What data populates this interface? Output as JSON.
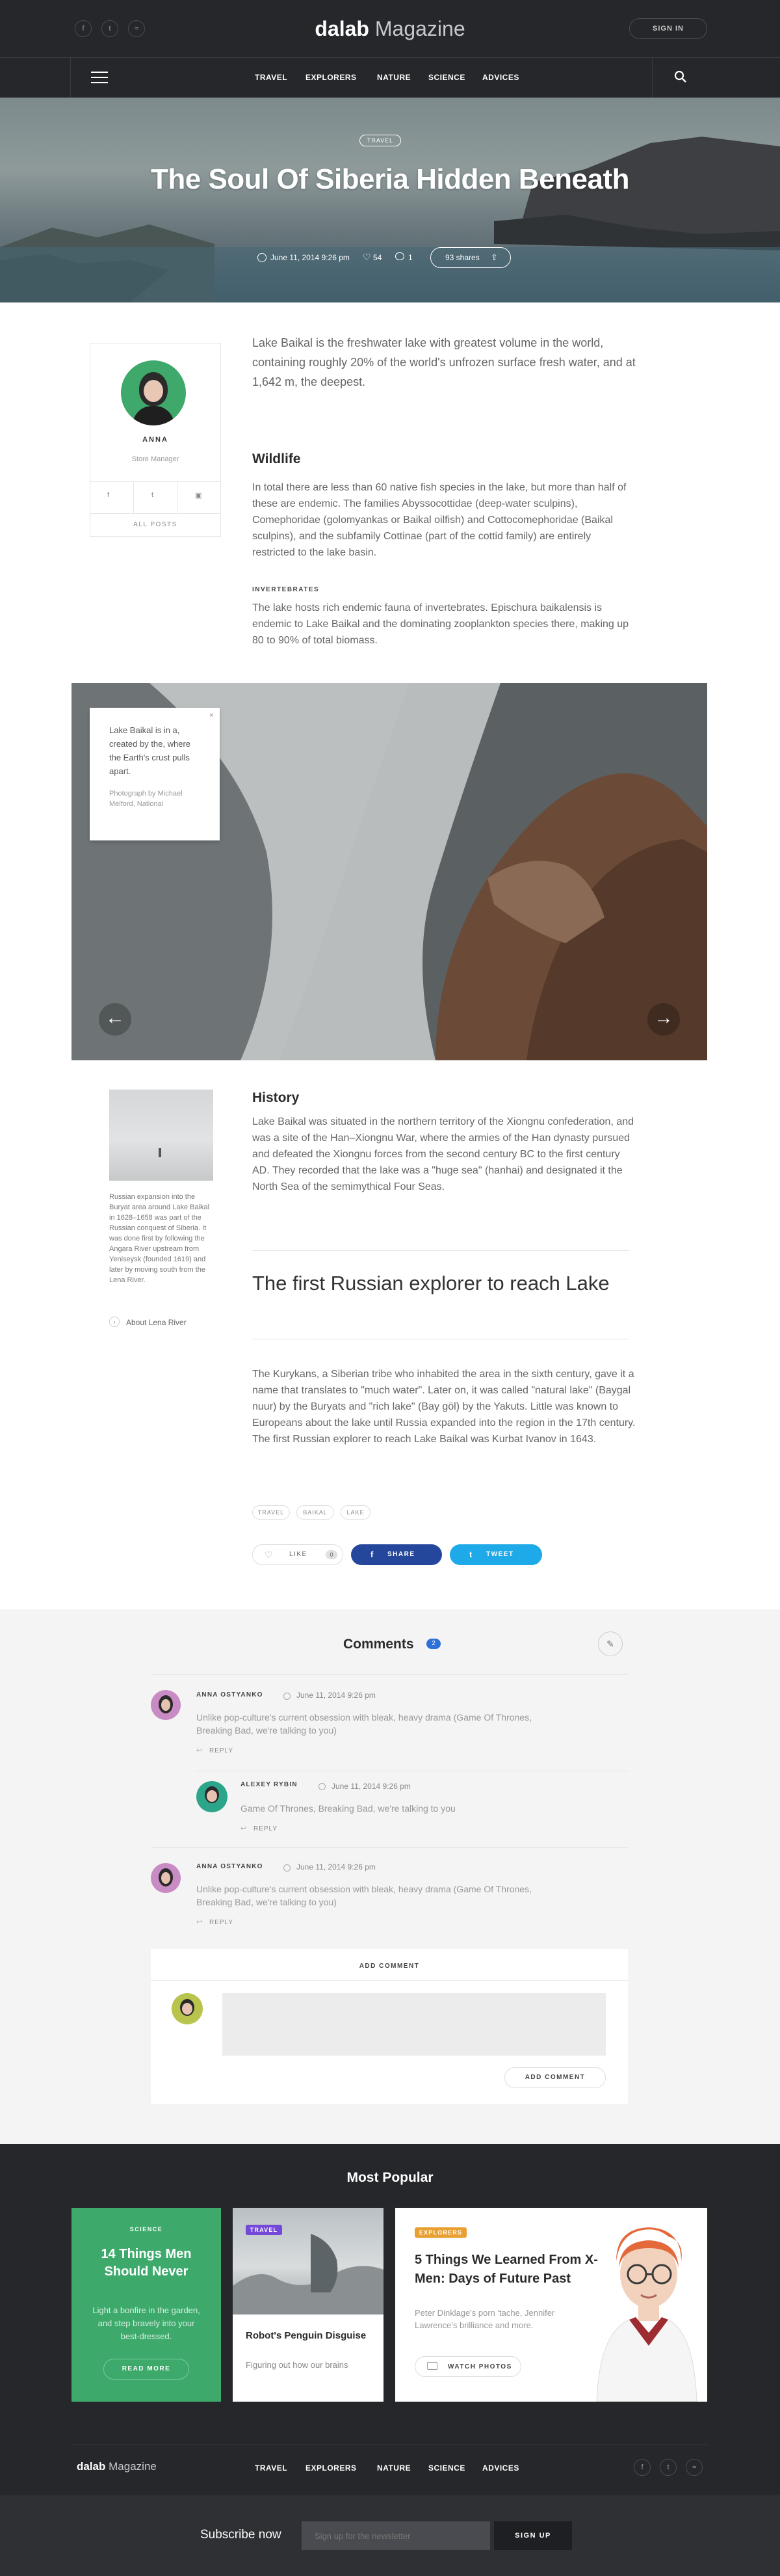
{
  "header": {
    "logo_bold": "dalab",
    "logo_light": "Magazine",
    "sign_in": "SIGN IN",
    "social_icons": [
      "facebook-icon",
      "twitter-icon",
      "rss-icon"
    ],
    "nav": [
      "TRAVEL",
      "EXPLORERS",
      "NATURE",
      "SCIENCE",
      "ADVICES"
    ]
  },
  "hero": {
    "category": "TRAVEL",
    "title": "The Soul Of Siberia Hidden Beneath",
    "date": "June 11, 2014 9:26 pm",
    "likes": "54",
    "comments": "1",
    "shares": "93 shares"
  },
  "author": {
    "name": "ANNA",
    "role": "Store Manager",
    "all_posts": "ALL POSTS"
  },
  "article": {
    "lead": "Lake Baikal is the freshwater lake with greatest volume in the world, containing roughly 20% of the world's unfrozen surface fresh water, and at 1,642 m, the deepest.",
    "wildlife_h": "Wildlife",
    "wildlife_p": "In total there are less than 60 native fish species in the lake, but more than half of these are endemic. The families Abyssocottidae (deep-water sculpins), Comephoridae (golomyankas or Baikal oilfish) and Cottocomephoridae (Baikal sculpins), and the subfamily Cottinae (part of the cottid family) are entirely restricted to the lake basin.",
    "invert_h": "INVERTEBRATES",
    "invert_p": "The lake hosts rich endemic fauna of invertebrates. Epischura baikalensis is endemic to Lake Baikal and the dominating zooplankton species there, making up 80 to 90% of total biomass.",
    "gallery_caption": "Lake Baikal is in a, created by the, where the Earth's crust pulls apart.",
    "gallery_credit": "Photograph by Michael Melford, National",
    "side_note": "Russian expansion into the Buryat area around Lake Baikal in 1628–1658 was part of the Russian conquest of Siberia. It was done first by following the Angara River upstream from Yeniseysk (founded 1619) and later by moving south from the Lena River.",
    "side_link": "About Lena River",
    "history_h": "History",
    "history_p": "Lake Baikal was situated in the northern territory of the Xiongnu confederation, and was a site of the Han–Xiongnu War, where the armies of the Han dynasty pursued and defeated the Xiongnu forces from the second century BC to the first century AD. They recorded that the lake was a \"huge sea\" (hanhai) and designated it the North Sea of the semimythical Four Seas.",
    "quote": "The first Russian explorer to reach Lake",
    "final_p": "The Kurykans, a Siberian tribe who inhabited the area in the sixth century, gave it a name that translates to \"much water\". Later on, it was called \"natural lake\" (Baygal nuur) by the Buryats and \"rich lake\" (Bay göl) by the Yakuts. Little was known to Europeans about the lake until Russia expanded into the region in the 17th century. The first Russian explorer to reach Lake Baikal was Kurbat Ivanov in 1643.",
    "tags": [
      "TRAVEL",
      "BAIKAL",
      "LAKE"
    ],
    "like_label": "LIKE",
    "like_count": "0",
    "share_label": "SHARE",
    "tweet_label": "TWEET"
  },
  "comments": {
    "heading": "Comments",
    "count": "2",
    "list": [
      {
        "name": "ANNA OSTYANKO",
        "date": "June 11, 2014 9:26 pm",
        "text": "Unlike pop-culture's current obsession with bleak, heavy drama (Game Of Thrones, Breaking Bad, we're talking to you)",
        "reply": "REPLY"
      },
      {
        "name": "ALEXEY RYBIN",
        "date": "June 11, 2014 9:26 pm",
        "text": "Game Of Thrones, Breaking Bad, we're talking to you",
        "reply": "REPLY"
      },
      {
        "name": "ANNA OSTYANKO",
        "date": "June 11, 2014 9:26 pm",
        "text": "Unlike pop-culture's current obsession with bleak, heavy drama (Game Of Thrones, Breaking Bad, we're talking to you)",
        "reply": "REPLY"
      }
    ],
    "add_heading": "ADD COMMENT",
    "add_button": "ADD COMMENT"
  },
  "popular": {
    "heading": "Most Popular",
    "cards": [
      {
        "category": "SCIENCE",
        "title": "14 Things Men Should Never",
        "text": "Light a bonfire in the garden, and step bravely into your best-dressed.",
        "button": "READ MORE"
      },
      {
        "category": "TRAVEL",
        "title": "Robot's Penguin Disguise",
        "text": "Figuring out how our brains"
      },
      {
        "category": "EXPLORERS",
        "title": "5 Things We Learned From X-Men: Days of Future Past",
        "text": "Peter Dinklage's porn 'tache, Jennifer Lawrence's brilliance and more.",
        "button": "WATCH PHOTOS"
      }
    ],
    "colors": {
      "science": "#3daa6c",
      "travel": "#7448d8",
      "explorers": "#e8a033"
    }
  },
  "footer": {
    "logo_bold": "dalab",
    "logo_light": "Magazine",
    "nav": [
      "TRAVEL",
      "EXPLORERS",
      "NATURE",
      "SCIENCE",
      "ADVICES"
    ],
    "subscribe_label": "Subscribe now",
    "subscribe_placeholder": "Sign up for the newsletter",
    "subscribe_button": "SIGN UP"
  },
  "colors": {
    "dark": "#26272b",
    "facebook": "#25479b",
    "twitter": "#1ea9e8",
    "accent_blue": "#2f6fd8"
  }
}
